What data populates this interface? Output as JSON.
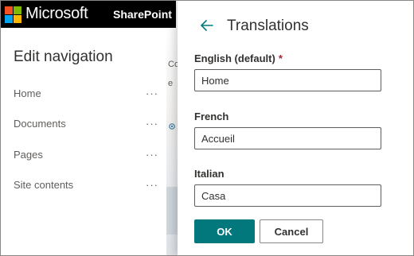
{
  "suite_bar": {
    "brand": "Microsoft",
    "app_name": "SharePoint"
  },
  "edit_navigation": {
    "title": "Edit navigation",
    "items": [
      {
        "label": "Home",
        "more": "···"
      },
      {
        "label": "Documents",
        "more": "···"
      },
      {
        "label": "Pages",
        "more": "···"
      },
      {
        "label": "Site contents",
        "more": "···"
      }
    ]
  },
  "background_page": {
    "peek_texts": [
      "Co",
      "e"
    ]
  },
  "translations_panel": {
    "title": "Translations",
    "fields": [
      {
        "label": "English (default)",
        "required_marker": "*",
        "value": "Home"
      },
      {
        "label": "French",
        "value": "Accueil"
      },
      {
        "label": "Italian",
        "value": "Casa"
      }
    ],
    "ok_label": "OK",
    "cancel_label": "Cancel"
  },
  "colors": {
    "accent": "#03787c",
    "back_arrow": "#03787c",
    "required": "#a4262c",
    "suite_bar": "#000000"
  },
  "icons": {
    "back": "back-arrow-icon",
    "more": "more-horizontal-icon"
  }
}
